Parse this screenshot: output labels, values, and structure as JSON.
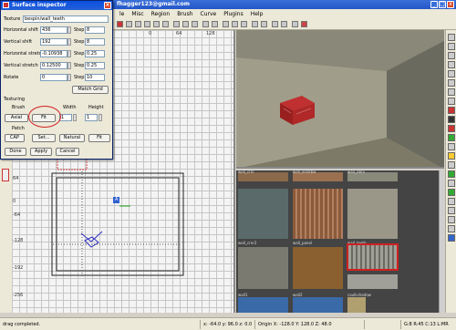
{
  "window": {
    "title": "fhagger123@gmail.com",
    "controls": [
      "_",
      "□",
      "x"
    ]
  },
  "menubar": {
    "items": [
      "le",
      "Misc",
      "Region",
      "Brush",
      "Curve",
      "Plugins",
      "Help"
    ]
  },
  "grid_view": {
    "left_labels": [
      "64",
      "0",
      "-64",
      "-128",
      "-192",
      "-256"
    ],
    "top_labels": [
      "-384",
      "-64",
      "0",
      "64",
      "128",
      "192",
      "256"
    ],
    "entity_label": "A"
  },
  "texture_browser": {
    "textures": [
      {
        "name": "wall_crnr",
        "color": "#8a6a4a"
      },
      {
        "name": "wall_endsbw",
        "color": "#9a7050"
      },
      {
        "name": "wall_nbrv",
        "color": "#8a8a7a"
      },
      {
        "name": "wall_crnr2",
        "color": "#5a6a6a"
      },
      {
        "name": "wall_panel",
        "color": "#8a5a3a"
      },
      {
        "name": "wall_teeth",
        "color": "#9a9688"
      },
      {
        "name": "",
        "color": "#7a7a70"
      },
      {
        "name": "",
        "color": "#8a6030"
      },
      {
        "name": "",
        "color": "#a0a098"
      },
      {
        "name": "wall1",
        "color": "#3a6aa8"
      },
      {
        "name": "wall2",
        "color": "#3a6aa8"
      },
      {
        "name": "caulkshadow",
        "color": "#b0a070"
      }
    ]
  },
  "status": {
    "message": "drag completed.",
    "coords": "x: -64.0  y: 96.0  z: 0.0",
    "origin": "Origin X: -128.0  Y: 128.0  Z: 48.0",
    "right": "G:8 R:45 C:13 L:MR"
  },
  "dialog": {
    "title": "Surface inspector",
    "texture_label": "Texture",
    "texture_value": "bespin/wall_teeth",
    "step_label": "Step",
    "rows": [
      {
        "label": "Horizontal shift",
        "value": "436",
        "step": "8"
      },
      {
        "label": "Vertical shift",
        "value": "192",
        "step": "8"
      },
      {
        "label": "Horizontal stretch",
        "value": "-0.10938",
        "step": "0.25"
      },
      {
        "label": "Vertical stretch",
        "value": "0.12500",
        "step": "0.25"
      },
      {
        "label": "Rotate",
        "value": "0",
        "step": "10"
      }
    ],
    "match_grid": "Match Grid",
    "texturing_label": "Texturing",
    "brush_label": "Brush",
    "width_label": "Width",
    "height_label": "Height",
    "axial": "Axial",
    "fit": "Fit",
    "width_value": "1",
    "height_value": "1",
    "patch_label": "Patch",
    "cap": "CAP",
    "set": "Set...",
    "natural": "Natural",
    "fit2": "Fit",
    "done": "Done",
    "apply": "Apply",
    "cancel": "Cancel"
  }
}
